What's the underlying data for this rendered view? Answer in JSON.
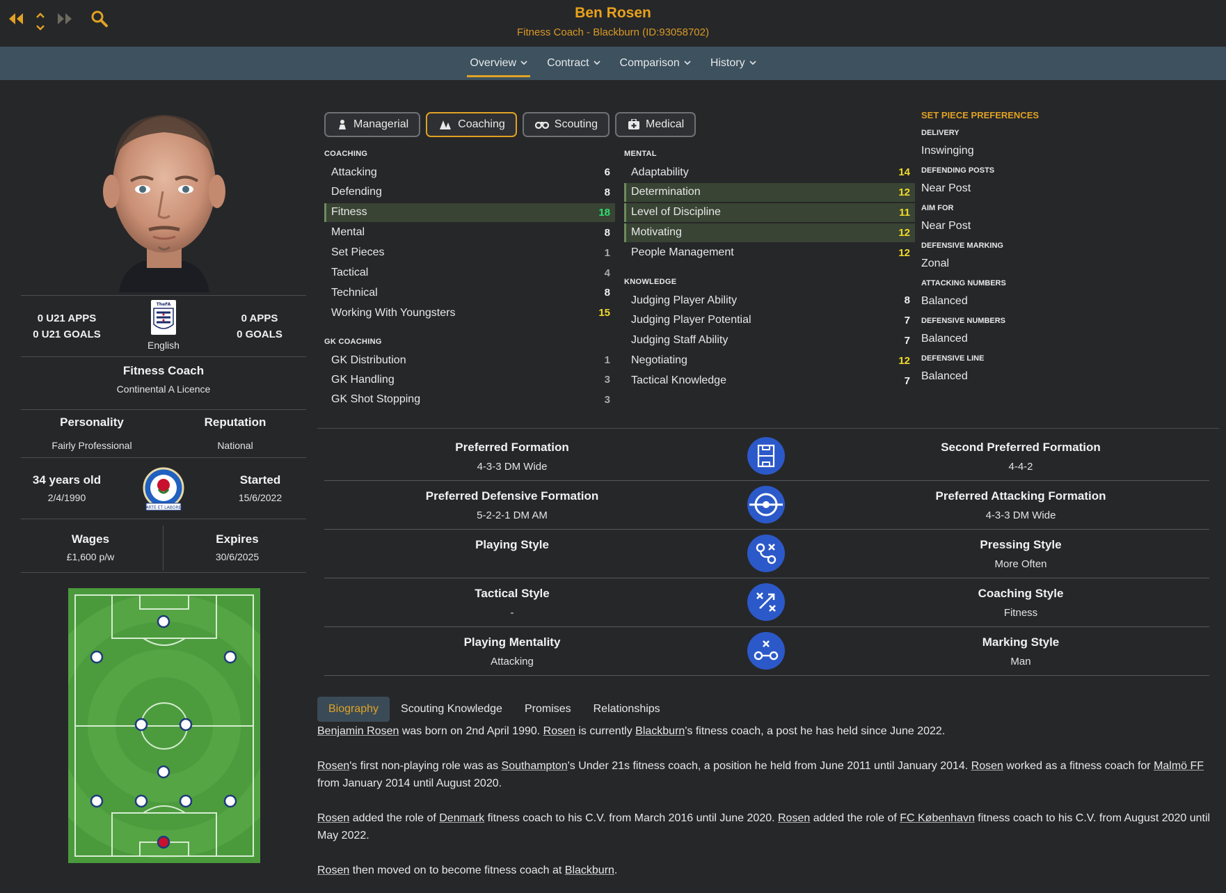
{
  "header": {
    "name": "Ben Rosen",
    "subtitle": "Fitness Coach - Blackburn (ID:93058702)"
  },
  "nav_tabs": [
    {
      "label": "Overview",
      "active": true
    },
    {
      "label": "Contract",
      "active": false
    },
    {
      "label": "Comparison",
      "active": false
    },
    {
      "label": "History",
      "active": false
    }
  ],
  "profile": {
    "u21_apps": "0 U21 APPS",
    "u21_goals": "0 U21 GOALS",
    "apps": "0 APPS",
    "goals": "0 GOALS",
    "nationality": "English",
    "role": "Fitness Coach",
    "licence": "Continental A Licence",
    "personality_label": "Personality",
    "personality": "Fairly Professional",
    "reputation_label": "Reputation",
    "reputation": "National",
    "age": "34 years old",
    "dob": "2/4/1990",
    "started_label": "Started",
    "started": "15/6/2022",
    "wages_label": "Wages",
    "wages": "£1,600 p/w",
    "expires_label": "Expires",
    "expires": "30/6/2025",
    "badge_text": "ARTE ET LABORE",
    "fa_text": "TheFA"
  },
  "attr_tabs": [
    {
      "label": "Managerial",
      "icon": "person-icon",
      "active": false
    },
    {
      "label": "Coaching",
      "icon": "cones-icon",
      "active": true
    },
    {
      "label": "Scouting",
      "icon": "binoculars-icon",
      "active": false
    },
    {
      "label": "Medical",
      "icon": "medkit-icon",
      "active": false
    }
  ],
  "coaching": {
    "title": "COACHING",
    "rows": [
      {
        "label": "Attacking",
        "value": "6",
        "color": "white",
        "hl": false
      },
      {
        "label": "Defending",
        "value": "8",
        "color": "white",
        "hl": false
      },
      {
        "label": "Fitness",
        "value": "18",
        "color": "green",
        "hl": true
      },
      {
        "label": "Mental",
        "value": "8",
        "color": "white",
        "hl": false
      },
      {
        "label": "Set Pieces",
        "value": "1",
        "color": "grey",
        "hl": false
      },
      {
        "label": "Tactical",
        "value": "4",
        "color": "grey",
        "hl": false
      },
      {
        "label": "Technical",
        "value": "8",
        "color": "white",
        "hl": false
      },
      {
        "label": "Working With Youngsters",
        "value": "15",
        "color": "yellow",
        "hl": false
      }
    ]
  },
  "gk": {
    "title": "GK COACHING",
    "rows": [
      {
        "label": "GK Distribution",
        "value": "1",
        "color": "grey",
        "hl": false
      },
      {
        "label": "GK Handling",
        "value": "3",
        "color": "grey",
        "hl": false
      },
      {
        "label": "GK Shot Stopping",
        "value": "3",
        "color": "grey",
        "hl": false
      }
    ]
  },
  "mental": {
    "title": "MENTAL",
    "rows": [
      {
        "label": "Adaptability",
        "value": "14",
        "color": "yellow",
        "hl": false
      },
      {
        "label": "Determination",
        "value": "12",
        "color": "yellow",
        "hl": true
      },
      {
        "label": "Level of Discipline",
        "value": "11",
        "color": "yellow",
        "hl": true
      },
      {
        "label": "Motivating",
        "value": "12",
        "color": "yellow",
        "hl": true
      },
      {
        "label": "People Management",
        "value": "12",
        "color": "yellow",
        "hl": false
      }
    ]
  },
  "knowledge": {
    "title": "KNOWLEDGE",
    "rows": [
      {
        "label": "Judging Player Ability",
        "value": "8",
        "color": "white",
        "hl": false
      },
      {
        "label": "Judging Player Potential",
        "value": "7",
        "color": "white",
        "hl": false
      },
      {
        "label": "Judging Staff Ability",
        "value": "7",
        "color": "white",
        "hl": false
      },
      {
        "label": "Negotiating",
        "value": "12",
        "color": "yellow",
        "hl": false
      },
      {
        "label": "Tactical Knowledge",
        "value": "7",
        "color": "white",
        "hl": false
      }
    ]
  },
  "set_piece": {
    "title": "SET PIECE PREFERENCES",
    "items": [
      {
        "label": "DELIVERY",
        "value": "Inswinging"
      },
      {
        "label": "DEFENDING POSTS",
        "value": "Near Post"
      },
      {
        "label": "AIM FOR",
        "value": "Near Post"
      },
      {
        "label": "DEFENSIVE MARKING",
        "value": "Zonal"
      },
      {
        "label": "ATTACKING NUMBERS",
        "value": "Balanced"
      },
      {
        "label": "DEFENSIVE NUMBERS",
        "value": "Balanced"
      },
      {
        "label": "DEFENSIVE LINE",
        "value": "Balanced"
      }
    ]
  },
  "formations": [
    {
      "left_title": "Preferred Formation",
      "left_value": "4-3-3 DM Wide",
      "icon": "pitch-icon",
      "right_title": "Second Preferred Formation",
      "right_value": "4-4-2"
    },
    {
      "left_title": "Preferred Defensive Formation",
      "left_value": "5-2-2-1 DM AM",
      "icon": "target-icon",
      "right_title": "Preferred Attacking Formation",
      "right_value": "4-3-3 DM Wide"
    },
    {
      "left_title": "Playing Style",
      "left_value": "",
      "icon": "tactics-icon",
      "right_title": "Pressing Style",
      "right_value": "More Often"
    },
    {
      "left_title": "Tactical Style",
      "left_value": "-",
      "icon": "arrows-icon",
      "right_title": "Coaching Style",
      "right_value": "Fitness"
    },
    {
      "left_title": "Playing Mentality",
      "left_value": "Attacking",
      "icon": "mentality-icon",
      "right_title": "Marking Style",
      "right_value": "Man"
    }
  ],
  "bio_tabs": [
    {
      "label": "Biography",
      "active": true
    },
    {
      "label": "Scouting Knowledge",
      "active": false
    },
    {
      "label": "Promises",
      "active": false
    },
    {
      "label": "Relationships",
      "active": false
    }
  ],
  "bio": {
    "p1": [
      {
        "t": "Benjamin Rosen",
        "link": true
      },
      {
        "t": " was born on 2nd April 1990. ",
        "link": false
      },
      {
        "t": "Rosen",
        "link": true
      },
      {
        "t": " is currently ",
        "link": false
      },
      {
        "t": "Blackburn",
        "link": true
      },
      {
        "t": "'s fitness coach, a post he has held since June 2022.",
        "link": false
      }
    ],
    "p2": [
      {
        "t": "Rosen",
        "link": true
      },
      {
        "t": "'s first non-playing role was as ",
        "link": false
      },
      {
        "t": "Southampton",
        "link": true
      },
      {
        "t": "'s Under 21s fitness coach, a position he held from June 2011 until January 2014. ",
        "link": false
      },
      {
        "t": "Rosen",
        "link": true
      },
      {
        "t": " worked as a fitness coach for ",
        "link": false
      },
      {
        "t": "Malmö FF",
        "link": true
      },
      {
        "t": " from January 2014 until August 2020.",
        "link": false
      }
    ],
    "p3": [
      {
        "t": "Rosen",
        "link": true
      },
      {
        "t": " added the role of ",
        "link": false
      },
      {
        "t": "Denmark",
        "link": true
      },
      {
        "t": " fitness coach to his C.V. from March 2016 until June 2020. ",
        "link": false
      },
      {
        "t": "Rosen",
        "link": true
      },
      {
        "t": " added the role of ",
        "link": false
      },
      {
        "t": "FC København",
        "link": true
      },
      {
        "t": " fitness coach to his C.V. from August 2020 until May 2022.",
        "link": false
      }
    ],
    "p4": [
      {
        "t": "Rosen",
        "link": true
      },
      {
        "t": " then moved on to become fitness coach at ",
        "link": false
      },
      {
        "t": "Blackburn",
        "link": true
      },
      {
        "t": ".",
        "link": false
      }
    ]
  },
  "colors": {
    "accent": "#e0a224",
    "background": "#262729",
    "tabstrip": "#3d515e",
    "value_yellow": "#f2db2a",
    "value_green": "#2de06e",
    "formation_icon": "#2c59c9",
    "pitch": "#5aa544"
  }
}
